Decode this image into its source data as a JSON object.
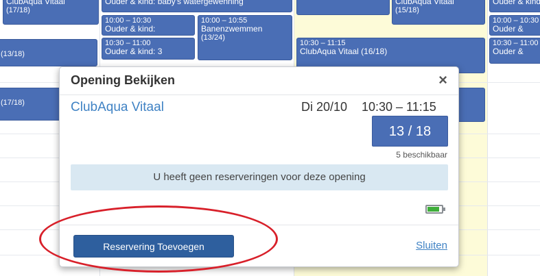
{
  "calendar": {
    "events": [
      {
        "title": "ClubAqua Vitaal",
        "count": "(17/18)"
      },
      {
        "title": "Ouder & kind: baby's watergewenning"
      },
      {
        "title": "ClubAqua Vitaal",
        "count": "(15/18)"
      },
      {
        "title": "Ouder & kind"
      },
      {
        "time": "10:00 – 10:30",
        "title": "Ouder & kind:"
      },
      {
        "time": "10:00 – 10:55",
        "title": "Banenzwemmen",
        "count": "(13/24)"
      },
      {
        "time": "10:00 – 10:30",
        "title": "Ouder &"
      },
      {
        "count": "(13/18)"
      },
      {
        "time": "10:30 – 11:00",
        "title": "Ouder & kind: 3"
      },
      {
        "time": "10:30 – 11:15",
        "title": "ClubAqua Vitaal (16/18)"
      },
      {
        "time": "10:30 – 11:00",
        "title": "Ouder &"
      },
      {
        "count": "(17/18)"
      }
    ]
  },
  "modal": {
    "title": "Opening Bekijken",
    "close_symbol": "×",
    "activity_name": "ClubAqua Vitaal",
    "date": "Di 20/10",
    "time": "10:30 – 11:15",
    "capacity": "13 / 18",
    "availability": "5 beschikbaar",
    "info_message": "U heeft geen reserveringen voor deze opening",
    "add_button_label": "Reservering Toevoegen",
    "close_link_label": "Sluiten"
  },
  "colors": {
    "event_blue": "#4a6eb5",
    "button_blue": "#2e5f9e",
    "link_blue": "#3f82c4",
    "banner_bg": "#d9e8f2",
    "highlight_column": "#fdfbd8",
    "annotation_red": "#d8202a",
    "battery_green": "#3fae3a"
  },
  "icons": {
    "close": "close-icon",
    "battery": "battery-icon"
  }
}
